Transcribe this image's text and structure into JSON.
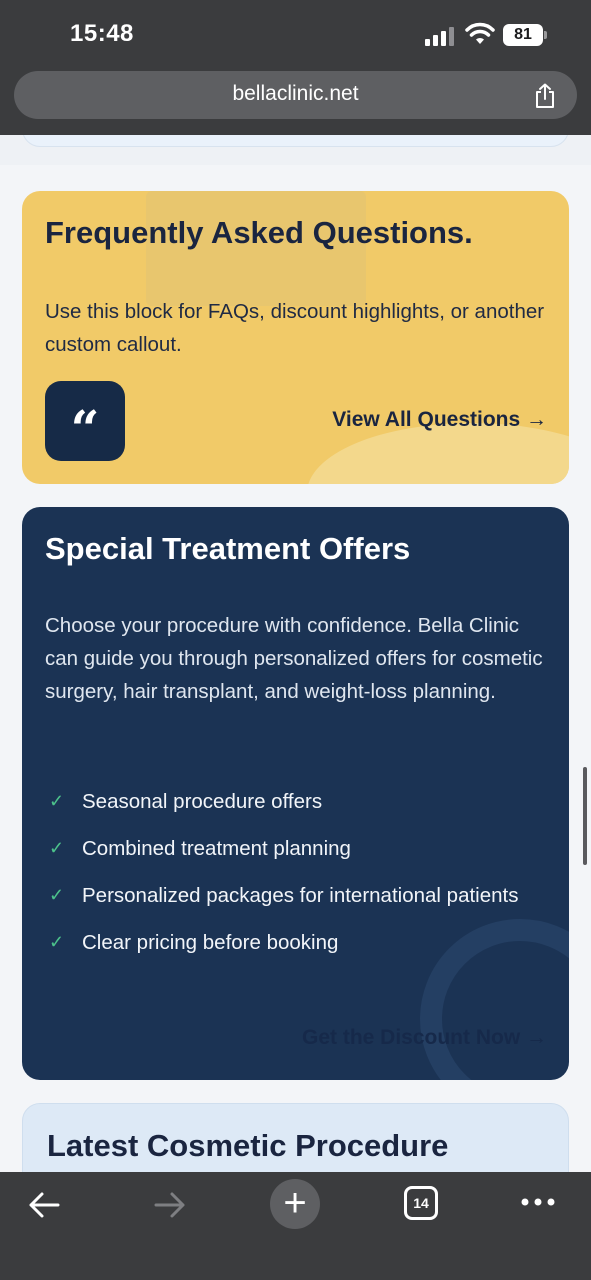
{
  "status_bar": {
    "time": "15:48",
    "battery": "81"
  },
  "browser": {
    "url": "bellaclinic.net",
    "tab_count": "14"
  },
  "faq_card": {
    "title": "Frequently Asked Questions.",
    "text": "Use this block for FAQs, discount highlights, or another custom callout.",
    "quote_glyph": "“",
    "link_label": "View All Questions →"
  },
  "offers_card": {
    "title": "Special Treatment Offers",
    "text": "Choose your procedure with confidence. Bella Clinic can guide you through personalized offers for cosmetic surgery, hair transplant, and weight-loss planning.",
    "items": [
      "Seasonal procedure offers",
      "Combined treatment planning",
      "Personalized packages for international patients",
      "Clear pricing before booking"
    ],
    "link_label": "Get the Discount Now →"
  },
  "latest_card": {
    "title": "Latest Cosmetic Procedure Guides"
  },
  "toolbar": {
    "new_tab_glyph": "+"
  },
  "colors": {
    "faq_bg": "#f1ca68",
    "offers_bg": "#1b3354",
    "check": "#4cc28b",
    "ink": "#1a2540"
  }
}
